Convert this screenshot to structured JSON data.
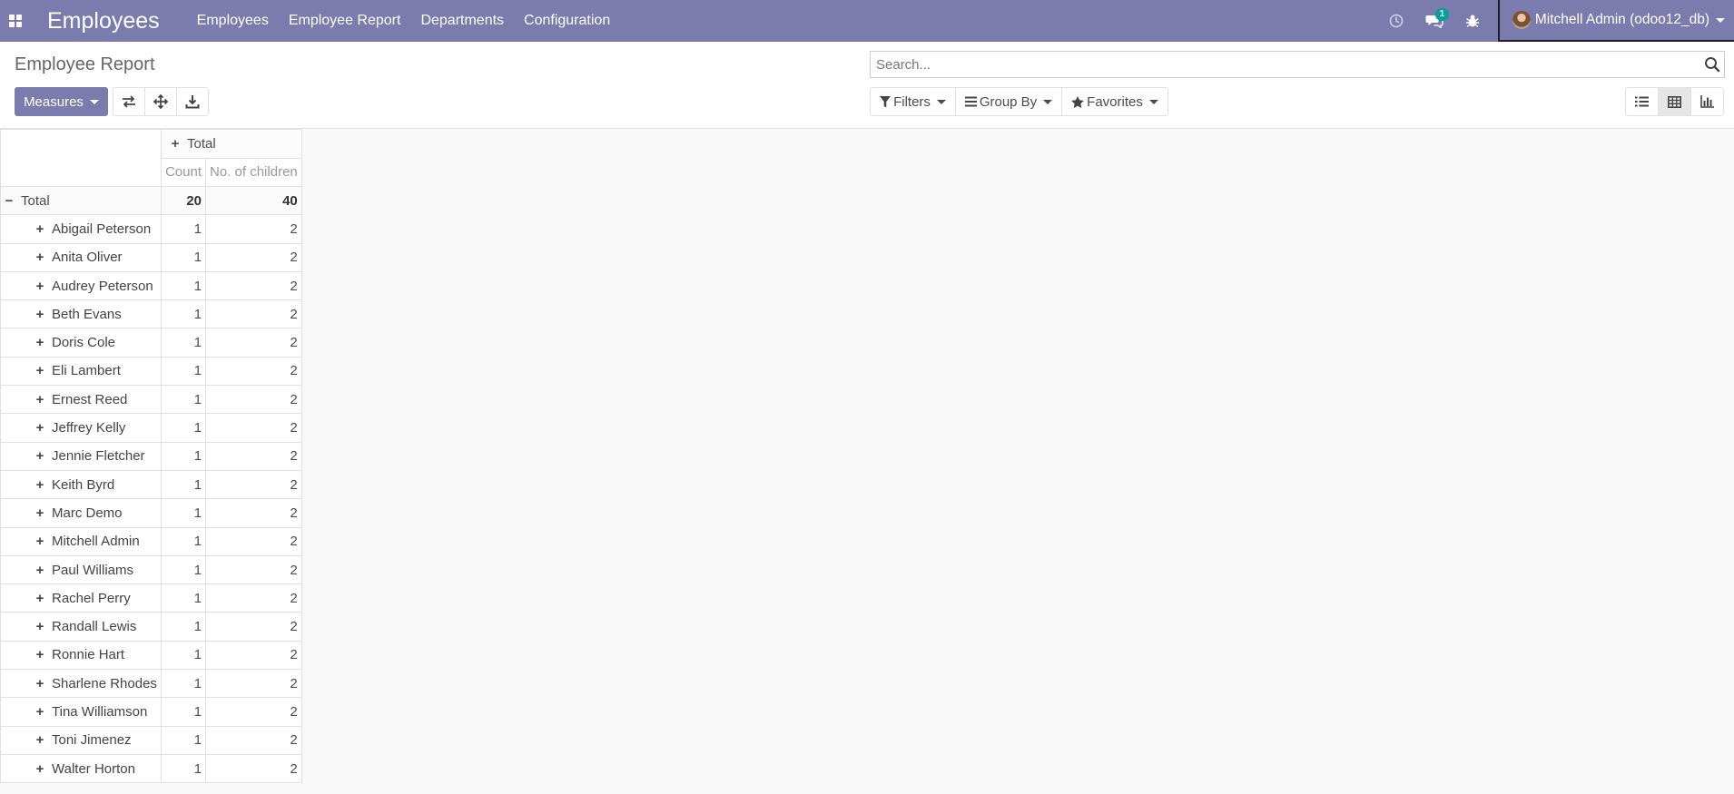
{
  "navbar": {
    "brand": "Employees",
    "menu": [
      "Employees",
      "Employee Report",
      "Departments",
      "Configuration"
    ],
    "messages_badge": "1",
    "user": "Mitchell Admin (odoo12_db)"
  },
  "control_panel": {
    "title": "Employee Report",
    "measures_label": "Measures",
    "search_placeholder": "Search...",
    "filters_label": "Filters",
    "groupby_label": "Group By",
    "favorites_label": "Favorites"
  },
  "pivot": {
    "col_header": "Total",
    "measures": [
      "Count",
      "No. of children"
    ],
    "total_row": {
      "label": "Total",
      "count": "20",
      "children": "40"
    },
    "rows": [
      {
        "name": "Abigail Peterson",
        "count": "1",
        "children": "2"
      },
      {
        "name": "Anita Oliver",
        "count": "1",
        "children": "2"
      },
      {
        "name": "Audrey Peterson",
        "count": "1",
        "children": "2"
      },
      {
        "name": "Beth Evans",
        "count": "1",
        "children": "2"
      },
      {
        "name": "Doris Cole",
        "count": "1",
        "children": "2"
      },
      {
        "name": "Eli Lambert",
        "count": "1",
        "children": "2"
      },
      {
        "name": "Ernest Reed",
        "count": "1",
        "children": "2"
      },
      {
        "name": "Jeffrey Kelly",
        "count": "1",
        "children": "2"
      },
      {
        "name": "Jennie Fletcher",
        "count": "1",
        "children": "2"
      },
      {
        "name": "Keith Byrd",
        "count": "1",
        "children": "2"
      },
      {
        "name": "Marc Demo",
        "count": "1",
        "children": "2"
      },
      {
        "name": "Mitchell Admin",
        "count": "1",
        "children": "2"
      },
      {
        "name": "Paul Williams",
        "count": "1",
        "children": "2"
      },
      {
        "name": "Rachel Perry",
        "count": "1",
        "children": "2"
      },
      {
        "name": "Randall Lewis",
        "count": "1",
        "children": "2"
      },
      {
        "name": "Ronnie Hart",
        "count": "1",
        "children": "2"
      },
      {
        "name": "Sharlene Rhodes",
        "count": "1",
        "children": "2"
      },
      {
        "name": "Tina Williamson",
        "count": "1",
        "children": "2"
      },
      {
        "name": "Toni Jimenez",
        "count": "1",
        "children": "2"
      },
      {
        "name": "Walter Horton",
        "count": "1",
        "children": "2"
      }
    ]
  },
  "colors": {
    "primary": "#7c7bad",
    "badge": "#00a09d"
  }
}
